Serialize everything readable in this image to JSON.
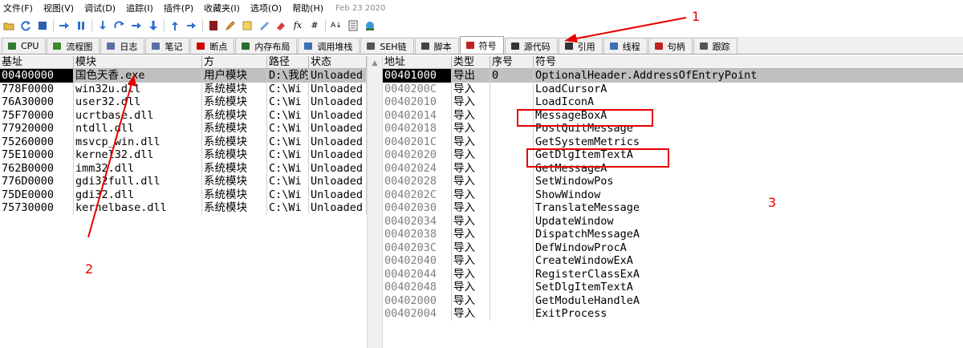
{
  "menu": {
    "items": [
      "文件(F)",
      "视图(V)",
      "调试(D)",
      "追踪(I)",
      "插件(P)",
      "收藏夹(I)",
      "选项(O)",
      "帮助(H)"
    ],
    "date": "Feb 23 2020"
  },
  "toolbar": {
    "fx_label": "fx",
    "hash_label": "#",
    "font_label": "A↓"
  },
  "tabs": [
    {
      "label": "CPU",
      "icon": "cpu-icon",
      "color": "#2f7d32"
    },
    {
      "label": "流程图",
      "icon": "graph-icon",
      "color": "#3a8a2a"
    },
    {
      "label": "日志",
      "icon": "log-icon",
      "color": "#5a6fa8"
    },
    {
      "label": "笔记",
      "icon": "notes-icon",
      "color": "#5a6fa8"
    },
    {
      "label": "断点",
      "icon": "breakpoint-icon",
      "color": "#d40000"
    },
    {
      "label": "内存布局",
      "icon": "memory-icon",
      "color": "#2e6b2e"
    },
    {
      "label": "调用堆栈",
      "icon": "callstack-icon",
      "color": "#3b6fb6"
    },
    {
      "label": "SEH链",
      "icon": "seh-icon",
      "color": "#555555"
    },
    {
      "label": "脚本",
      "icon": "script-icon",
      "color": "#444444"
    },
    {
      "label": "符号",
      "icon": "symbol-icon",
      "color": "#c02020",
      "active": true
    },
    {
      "label": "源代码",
      "icon": "source-icon",
      "color": "#333333"
    },
    {
      "label": "引用",
      "icon": "reference-icon",
      "color": "#333333"
    },
    {
      "label": "线程",
      "icon": "thread-icon",
      "color": "#3b6fb6"
    },
    {
      "label": "句柄",
      "icon": "handle-icon",
      "color": "#c02020"
    },
    {
      "label": "跟踪",
      "icon": "trace-icon",
      "color": "#555555"
    }
  ],
  "modules": {
    "headers": [
      "基址",
      "模块",
      "方",
      "路径",
      "状态"
    ],
    "rows": [
      {
        "base": "00400000",
        "name": "国色天香.exe",
        "party": "用户模块",
        "path": "D:\\我的",
        "status": "Unloaded",
        "selected": true
      },
      {
        "base": "778F0000",
        "name": "win32u.dll",
        "party": "系统模块",
        "path": "C:\\Wi",
        "status": "Unloaded"
      },
      {
        "base": "76A30000",
        "name": "user32.dll",
        "party": "系统模块",
        "path": "C:\\Wi",
        "status": "Unloaded"
      },
      {
        "base": "75F70000",
        "name": "ucrtbase.dll",
        "party": "系统模块",
        "path": "C:\\Wi",
        "status": "Unloaded"
      },
      {
        "base": "77920000",
        "name": "ntdll.dll",
        "party": "系统模块",
        "path": "C:\\Wi",
        "status": "Unloaded"
      },
      {
        "base": "75260000",
        "name": "msvcp_win.dll",
        "party": "系统模块",
        "path": "C:\\Wi",
        "status": "Unloaded"
      },
      {
        "base": "75E10000",
        "name": "kernel32.dll",
        "party": "系统模块",
        "path": "C:\\Wi",
        "status": "Unloaded"
      },
      {
        "base": "762B0000",
        "name": "imm32.dll",
        "party": "系统模块",
        "path": "C:\\Wi",
        "status": "Unloaded"
      },
      {
        "base": "776D0000",
        "name": "gdi32full.dll",
        "party": "系统模块",
        "path": "C:\\Wi",
        "status": "Unloaded"
      },
      {
        "base": "75DE0000",
        "name": "gdi32.dll",
        "party": "系统模块",
        "path": "C:\\Wi",
        "status": "Unloaded"
      },
      {
        "base": "75730000",
        "name": "kernelbase.dll",
        "party": "系统模块",
        "path": "C:\\Wi",
        "status": "Unloaded"
      }
    ]
  },
  "symbols": {
    "headers": [
      "地址",
      "类型",
      "序号",
      "符号"
    ],
    "rows": [
      {
        "addr": "00401000",
        "type": "导出",
        "ord": "0",
        "sym": "OptionalHeader.AddressOfEntryPoint",
        "selected": true
      },
      {
        "addr": "0040200C",
        "type": "导入",
        "ord": "",
        "sym": "LoadCursorA"
      },
      {
        "addr": "00402010",
        "type": "导入",
        "ord": "",
        "sym": "LoadIconA"
      },
      {
        "addr": "00402014",
        "type": "导入",
        "ord": "",
        "sym": "MessageBoxA"
      },
      {
        "addr": "00402018",
        "type": "导入",
        "ord": "",
        "sym": "PostQuitMessage"
      },
      {
        "addr": "0040201C",
        "type": "导入",
        "ord": "",
        "sym": "GetSystemMetrics"
      },
      {
        "addr": "00402020",
        "type": "导入",
        "ord": "",
        "sym": "GetDlgItemTextA"
      },
      {
        "addr": "00402024",
        "type": "导入",
        "ord": "",
        "sym": "GetMessageA"
      },
      {
        "addr": "00402028",
        "type": "导入",
        "ord": "",
        "sym": "SetWindowPos"
      },
      {
        "addr": "0040202C",
        "type": "导入",
        "ord": "",
        "sym": "ShowWindow"
      },
      {
        "addr": "00402030",
        "type": "导入",
        "ord": "",
        "sym": "TranslateMessage"
      },
      {
        "addr": "00402034",
        "type": "导入",
        "ord": "",
        "sym": "UpdateWindow"
      },
      {
        "addr": "00402038",
        "type": "导入",
        "ord": "",
        "sym": "DispatchMessageA"
      },
      {
        "addr": "0040203C",
        "type": "导入",
        "ord": "",
        "sym": "DefWindowProcA"
      },
      {
        "addr": "00402040",
        "type": "导入",
        "ord": "",
        "sym": "CreateWindowExA"
      },
      {
        "addr": "00402044",
        "type": "导入",
        "ord": "",
        "sym": "RegisterClassExA"
      },
      {
        "addr": "00402048",
        "type": "导入",
        "ord": "",
        "sym": "SetDlgItemTextA"
      },
      {
        "addr": "00402000",
        "type": "导入",
        "ord": "",
        "sym": "GetModuleHandleA"
      },
      {
        "addr": "00402004",
        "type": "导入",
        "ord": "",
        "sym": "ExitProcess"
      }
    ]
  },
  "annotations": {
    "labels": [
      "1",
      "2",
      "3"
    ],
    "color": "#e60000"
  }
}
